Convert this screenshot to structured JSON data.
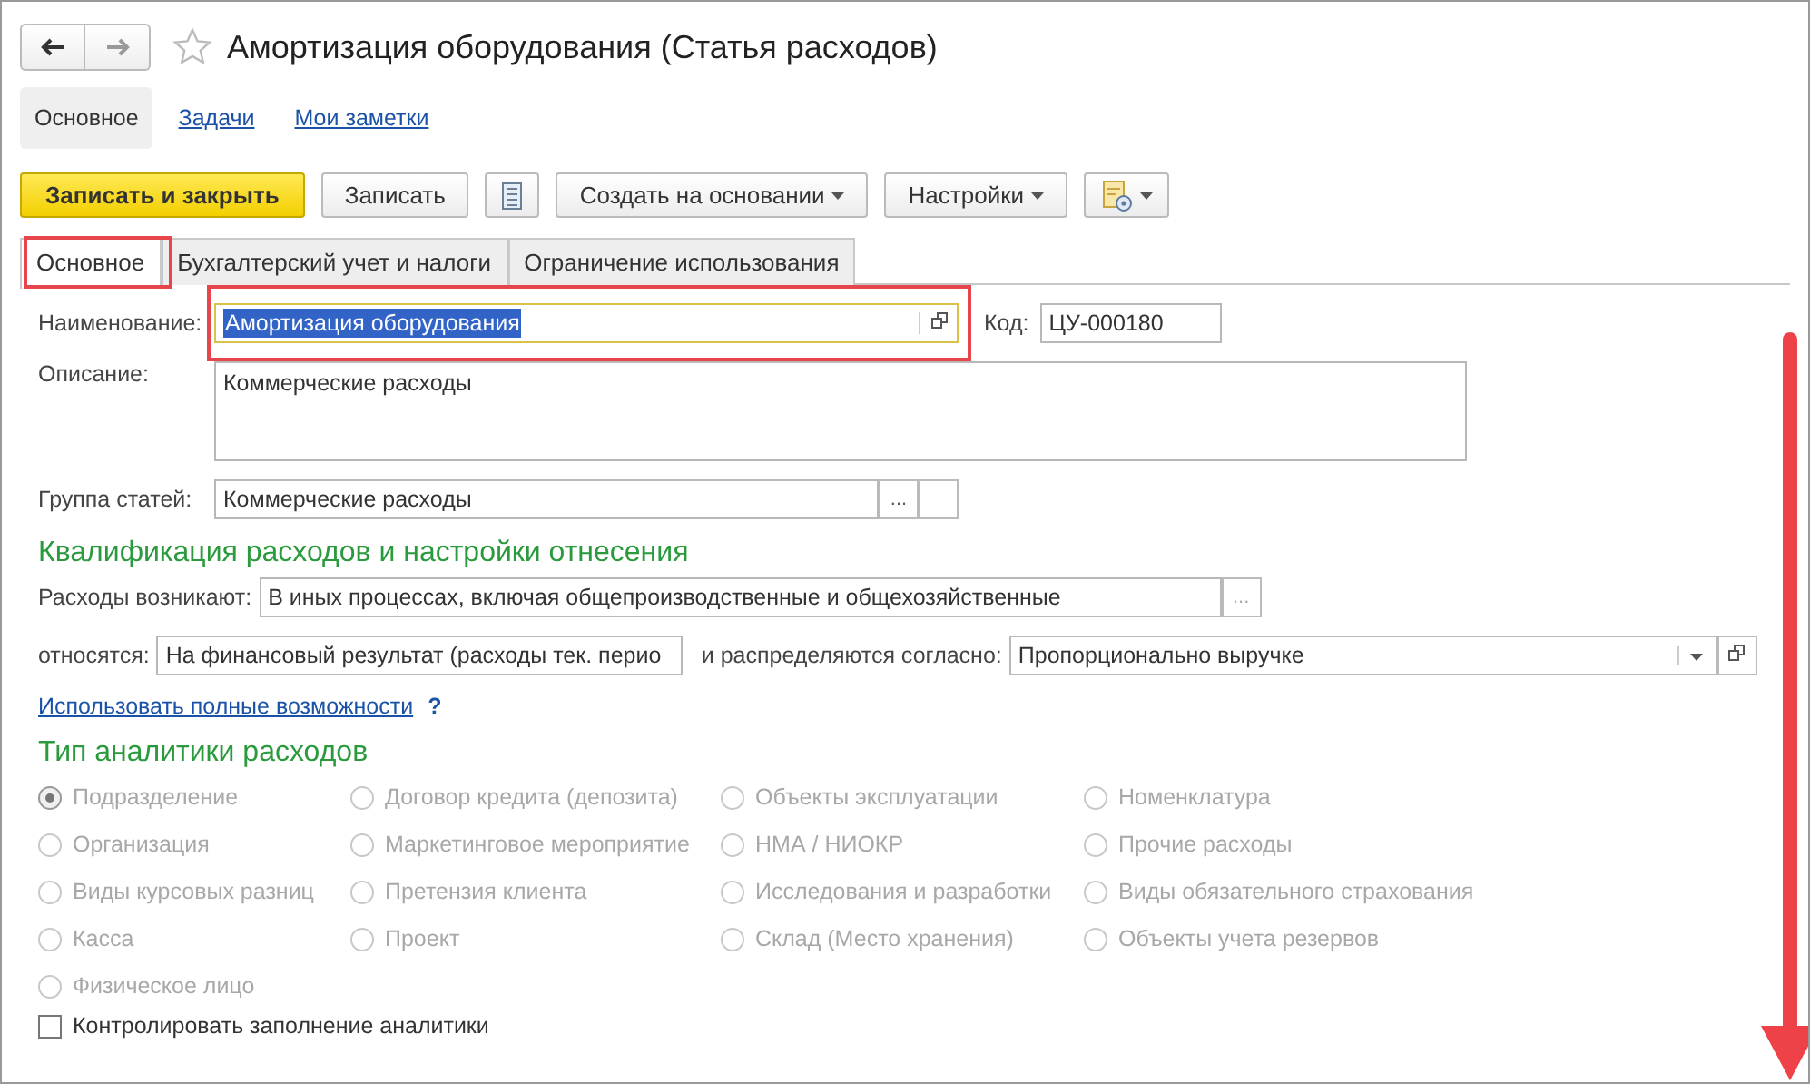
{
  "window": {
    "title": "Амортизация оборудования (Статья расходов)"
  },
  "section_tabs": [
    {
      "label": "Основное",
      "selected": true
    },
    {
      "label": "Задачи",
      "selected": false
    },
    {
      "label": "Мои заметки",
      "selected": false
    }
  ],
  "toolbar": [
    {
      "kind": "primary",
      "label": "Записать и закрыть"
    },
    {
      "kind": "plain",
      "label": "Записать"
    },
    {
      "kind": "icon"
    },
    {
      "kind": "dropdown",
      "label": "Создать на основании"
    },
    {
      "kind": "dropdown",
      "label": "Настройки"
    },
    {
      "kind": "icon-dropdown"
    }
  ],
  "form_tabs": [
    {
      "label": "Основное",
      "selected": true
    },
    {
      "label": "Бухгалтерский учет и налоги",
      "selected": false
    },
    {
      "label": "Ограничение использования",
      "selected": false
    }
  ],
  "name": {
    "label": "Наименование:",
    "value": "Амортизация оборудования"
  },
  "code": {
    "label": "Код:",
    "value": "ЦУ-000180"
  },
  "description": {
    "label": "Описание:",
    "value": "Коммерческие расходы"
  },
  "group": {
    "label": "Группа статей:",
    "value": "Коммерческие расходы",
    "button": "..."
  },
  "qualification": {
    "heading": "Квалификация расходов и настройки отнесения",
    "arise": {
      "label": "Расходы возникают:",
      "value": "В иных процессах, включая общепроизводственные и общехозяйственные",
      "button": "..."
    },
    "relate": {
      "label": "относятся:",
      "value": "На финансовый результат (расходы тек. перио"
    },
    "distribute": {
      "label": "и распределяются согласно:",
      "value": "Пропорционально выручке"
    },
    "link": "Использовать полные возможности",
    "help": "?"
  },
  "analytics": {
    "heading": "Тип аналитики расходов",
    "disabled": true,
    "columns": [
      [
        {
          "label": "Подразделение",
          "selected": true
        },
        {
          "label": "Организация",
          "selected": false
        },
        {
          "label": "Виды курсовых разниц",
          "selected": false
        },
        {
          "label": "Касса",
          "selected": false
        },
        {
          "label": "Физическое лицо",
          "selected": false
        }
      ],
      [
        {
          "label": "Договор кредита (депозита)",
          "selected": false
        },
        {
          "label": "Маркетинговое мероприятие",
          "selected": false
        },
        {
          "label": "Претензия клиента",
          "selected": false
        },
        {
          "label": "Проект",
          "selected": false
        }
      ],
      [
        {
          "label": "Объекты эксплуатации",
          "selected": false
        },
        {
          "label": "НМА / НИОКР",
          "selected": false
        },
        {
          "label": "Исследования и разработки",
          "selected": false
        },
        {
          "label": "Склад (Место хранения)",
          "selected": false
        }
      ],
      [
        {
          "label": "Номенклатура",
          "selected": false
        },
        {
          "label": "Прочие расходы",
          "selected": false
        },
        {
          "label": "Виды обязательного страхования",
          "selected": false
        },
        {
          "label": "Объекты учета резервов",
          "selected": false
        }
      ]
    ]
  },
  "control_fill": {
    "label": "Контролировать заполнение аналитики",
    "checked": false
  }
}
